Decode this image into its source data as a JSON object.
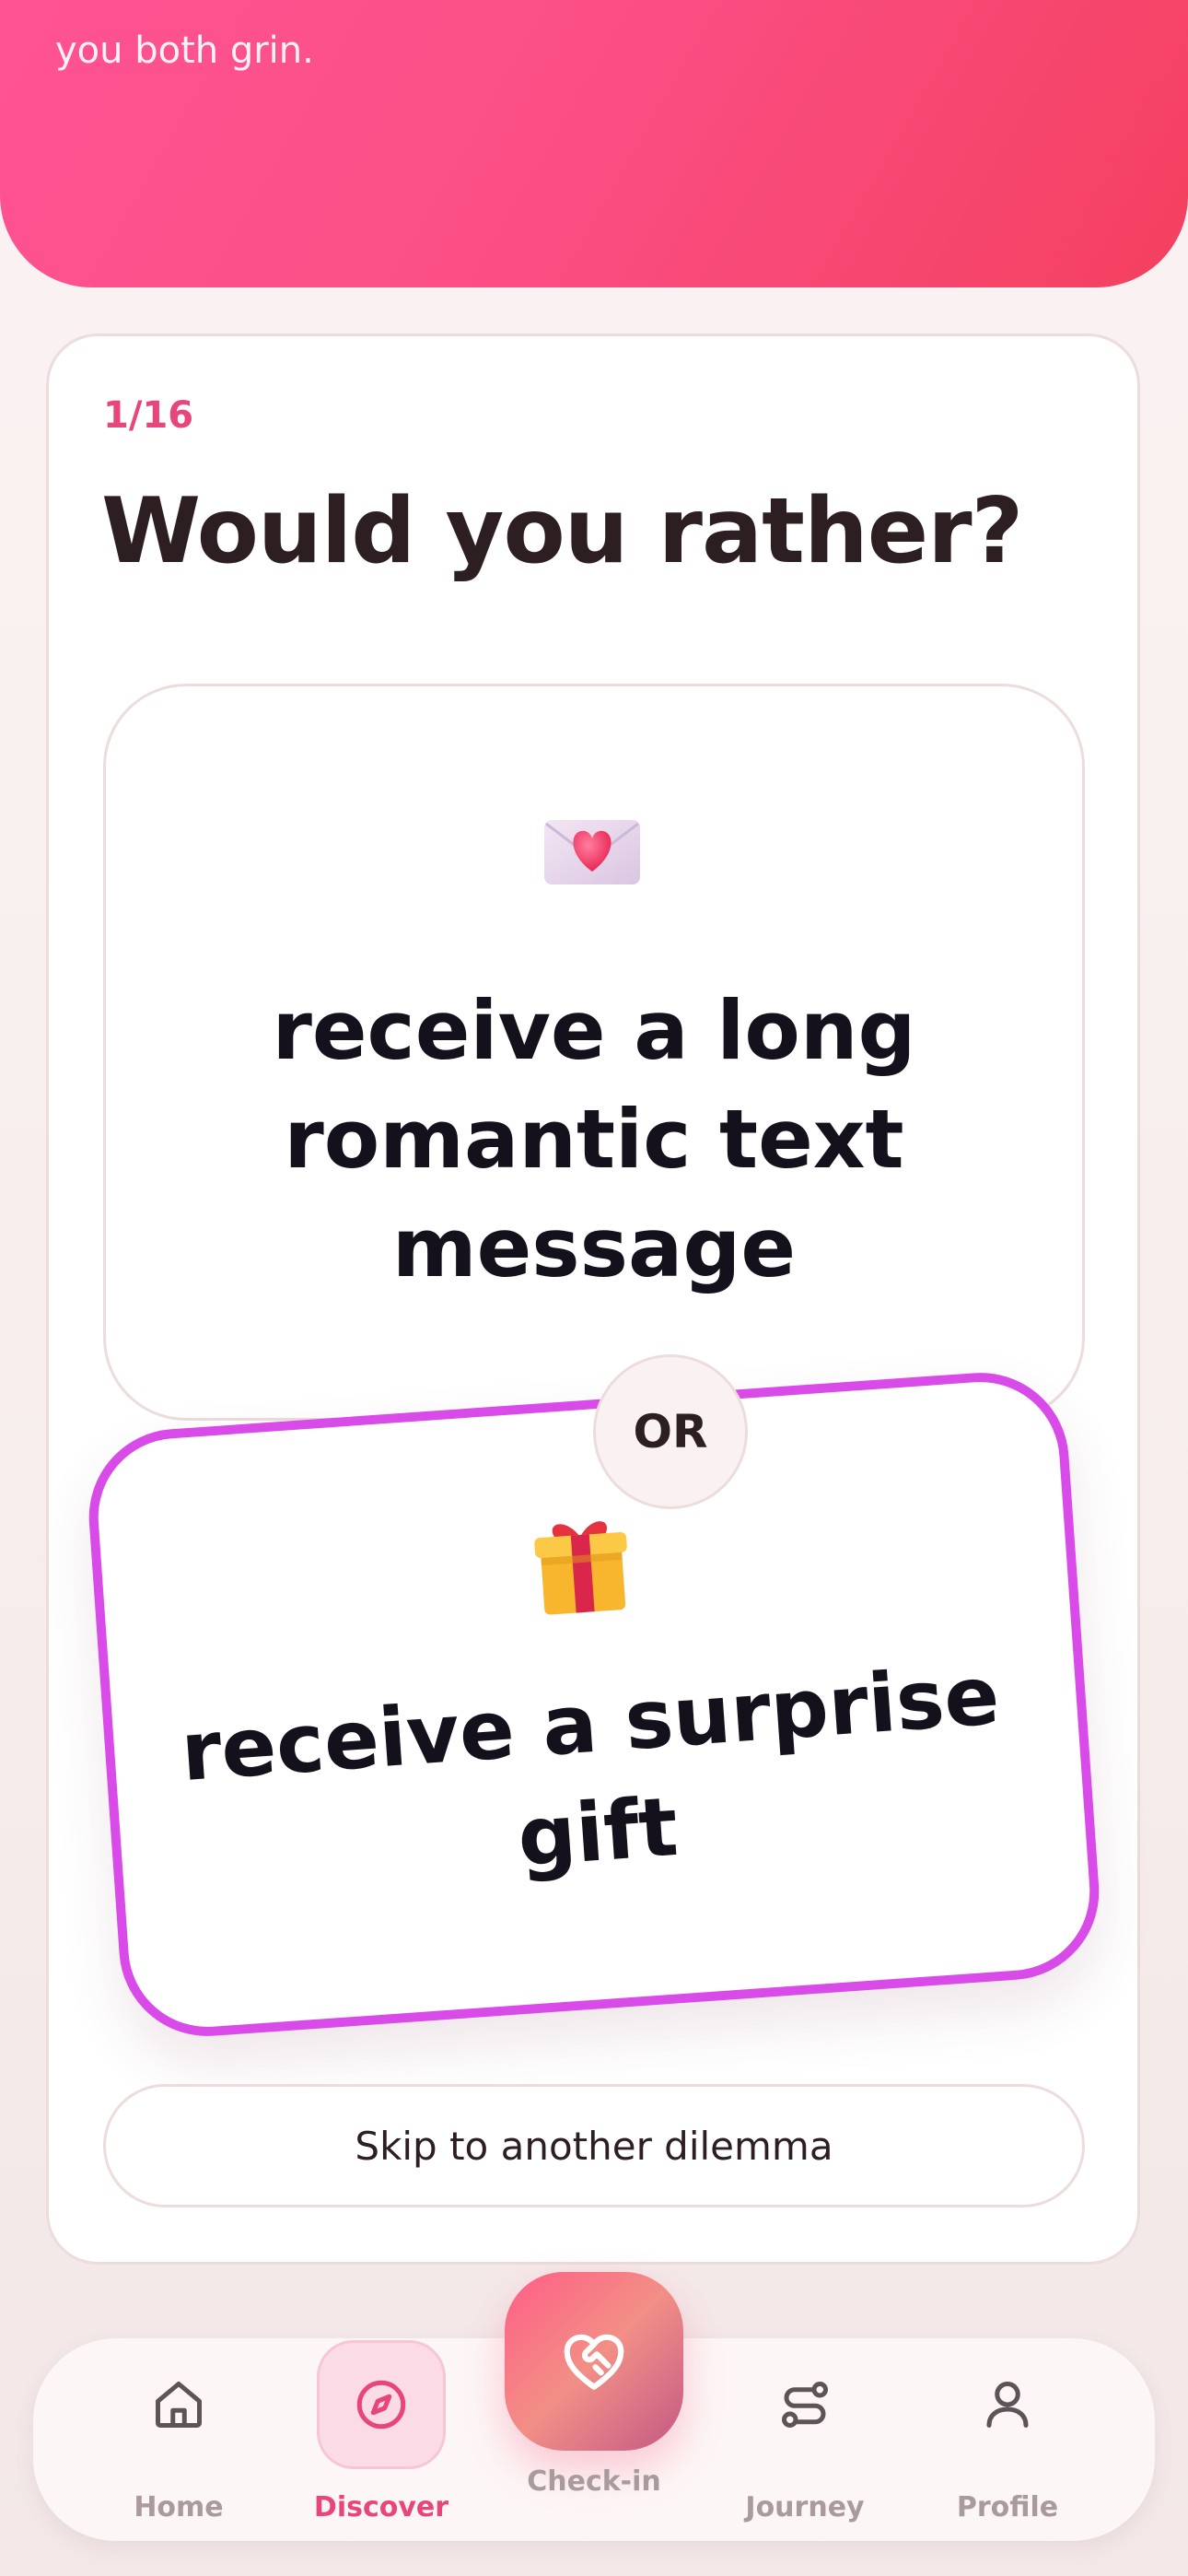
{
  "header": {
    "partial_text": "preferences, priorities, and what makes\nyou both grin."
  },
  "game": {
    "progress": "1/16",
    "title": "Would you rather?",
    "option_a": {
      "icon": "love-letter-icon",
      "text": "receive a long romantic text message"
    },
    "or_label": "OR",
    "option_b": {
      "icon": "gift-icon",
      "text": "receive a surprise gift"
    },
    "skip_label": "Skip to another dilemma"
  },
  "nav": {
    "items": [
      {
        "label": "Home",
        "icon": "home-icon",
        "active": false
      },
      {
        "label": "Discover",
        "icon": "compass-icon",
        "active": true
      },
      {
        "label": "Check-in",
        "icon": "heart-handshake-icon",
        "active": false
      },
      {
        "label": "Journey",
        "icon": "route-icon",
        "active": false
      },
      {
        "label": "Profile",
        "icon": "user-icon",
        "active": false
      }
    ]
  },
  "colors": {
    "accent": "#e8457a",
    "header_gradient_start": "#ff5393",
    "header_gradient_end": "#f4405f",
    "selected_border": "#d94be8"
  }
}
